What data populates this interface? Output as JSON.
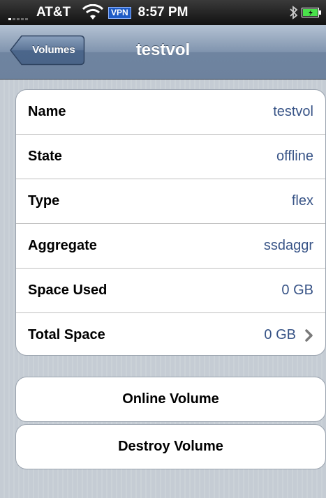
{
  "status_bar": {
    "carrier": "AT&T",
    "vpn": "VPN",
    "time": "8:57 PM"
  },
  "nav": {
    "back_label": "Volumes",
    "title": "testvol"
  },
  "details": [
    {
      "label": "Name",
      "value": "testvol"
    },
    {
      "label": "State",
      "value": "offline"
    },
    {
      "label": "Type",
      "value": "flex"
    },
    {
      "label": "Aggregate",
      "value": "ssdaggr"
    },
    {
      "label": "Space Used",
      "value": "0 GB"
    },
    {
      "label": "Total Space",
      "value": "0 GB"
    }
  ],
  "actions": {
    "online_label": "Online Volume",
    "destroy_label": "Destroy Volume"
  },
  "colors": {
    "value_text": "#385487",
    "nav_bar": "#7b8fa9",
    "background": "#c5ccd4"
  }
}
